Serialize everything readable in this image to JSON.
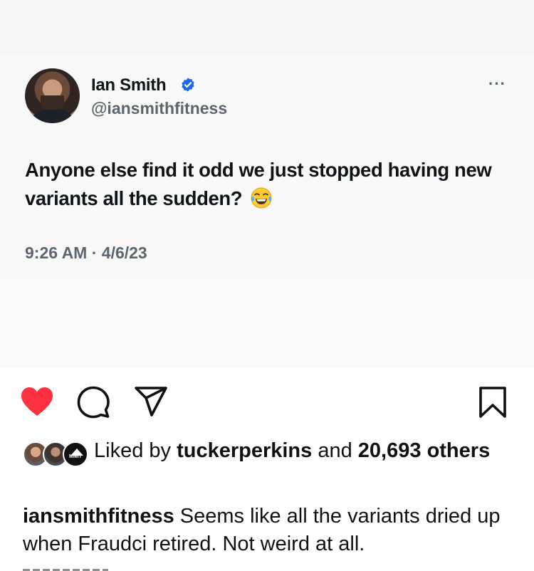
{
  "tweet": {
    "display_name": "Ian Smith",
    "handle": "@iansmithfitness",
    "text": "Anyone else find it odd we just stopped having new variants all the sudden?",
    "emoji": "face-with-tears-of-joy-icon",
    "timestamp": "9:26 AM · 4/6/23",
    "more_label": "···",
    "verified_color": "#1d6ae5"
  },
  "post": {
    "liked_by_prefix": "Liked by",
    "liked_by_user": "tuckerperkins",
    "liked_by_and": "and",
    "likes_count": "20,693",
    "likes_suffix": "others",
    "liker_badge_text": "MMIT",
    "caption_username": "iansmithfitness",
    "caption_text": "Seems like all the variants dried up when Fraudci retired. Not weird at all.",
    "heart_color": "#ff3040",
    "liked": true
  },
  "icons": [
    "heart-icon",
    "comment-icon",
    "share-icon",
    "bookmark-icon",
    "verified-icon",
    "more-icon"
  ]
}
